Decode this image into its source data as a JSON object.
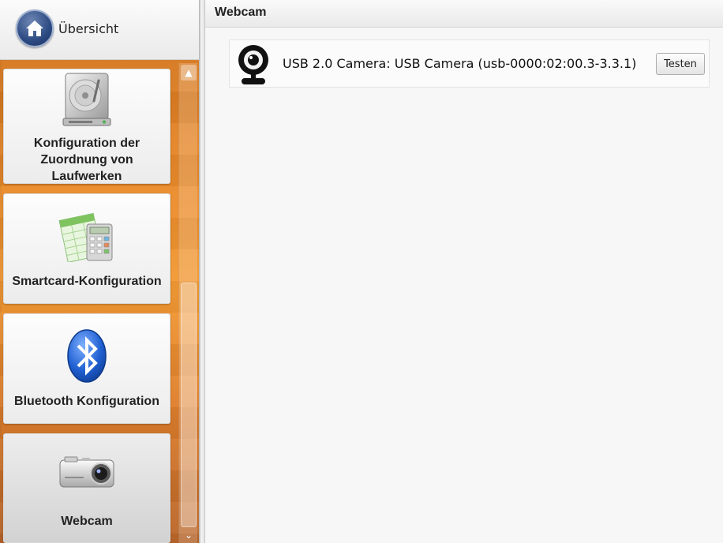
{
  "sidebar": {
    "overview_label": "Übersicht",
    "tiles": [
      {
        "label": "Konfiguration der Zuordnung von Laufwerken",
        "icon": "hard-drive-icon"
      },
      {
        "label": "Smartcard-Konfiguration",
        "icon": "spreadsheet-calculator-icon"
      },
      {
        "label": "Bluetooth Konfiguration",
        "icon": "bluetooth-icon"
      },
      {
        "label": "Webcam",
        "icon": "camera-icon"
      }
    ],
    "active_tile": "Webcam"
  },
  "main": {
    "title": "Webcam",
    "devices": [
      {
        "name": "USB 2.0 Camera: USB Camera (usb-0000:02:00.3-3.3.1)",
        "button_label": "Testen",
        "icon": "webcam-icon"
      }
    ]
  },
  "colors": {
    "sidebar_orange": "#e98a2a",
    "home_button_blue": "#2c4a82",
    "bluetooth_blue": "#1f5fd1"
  }
}
